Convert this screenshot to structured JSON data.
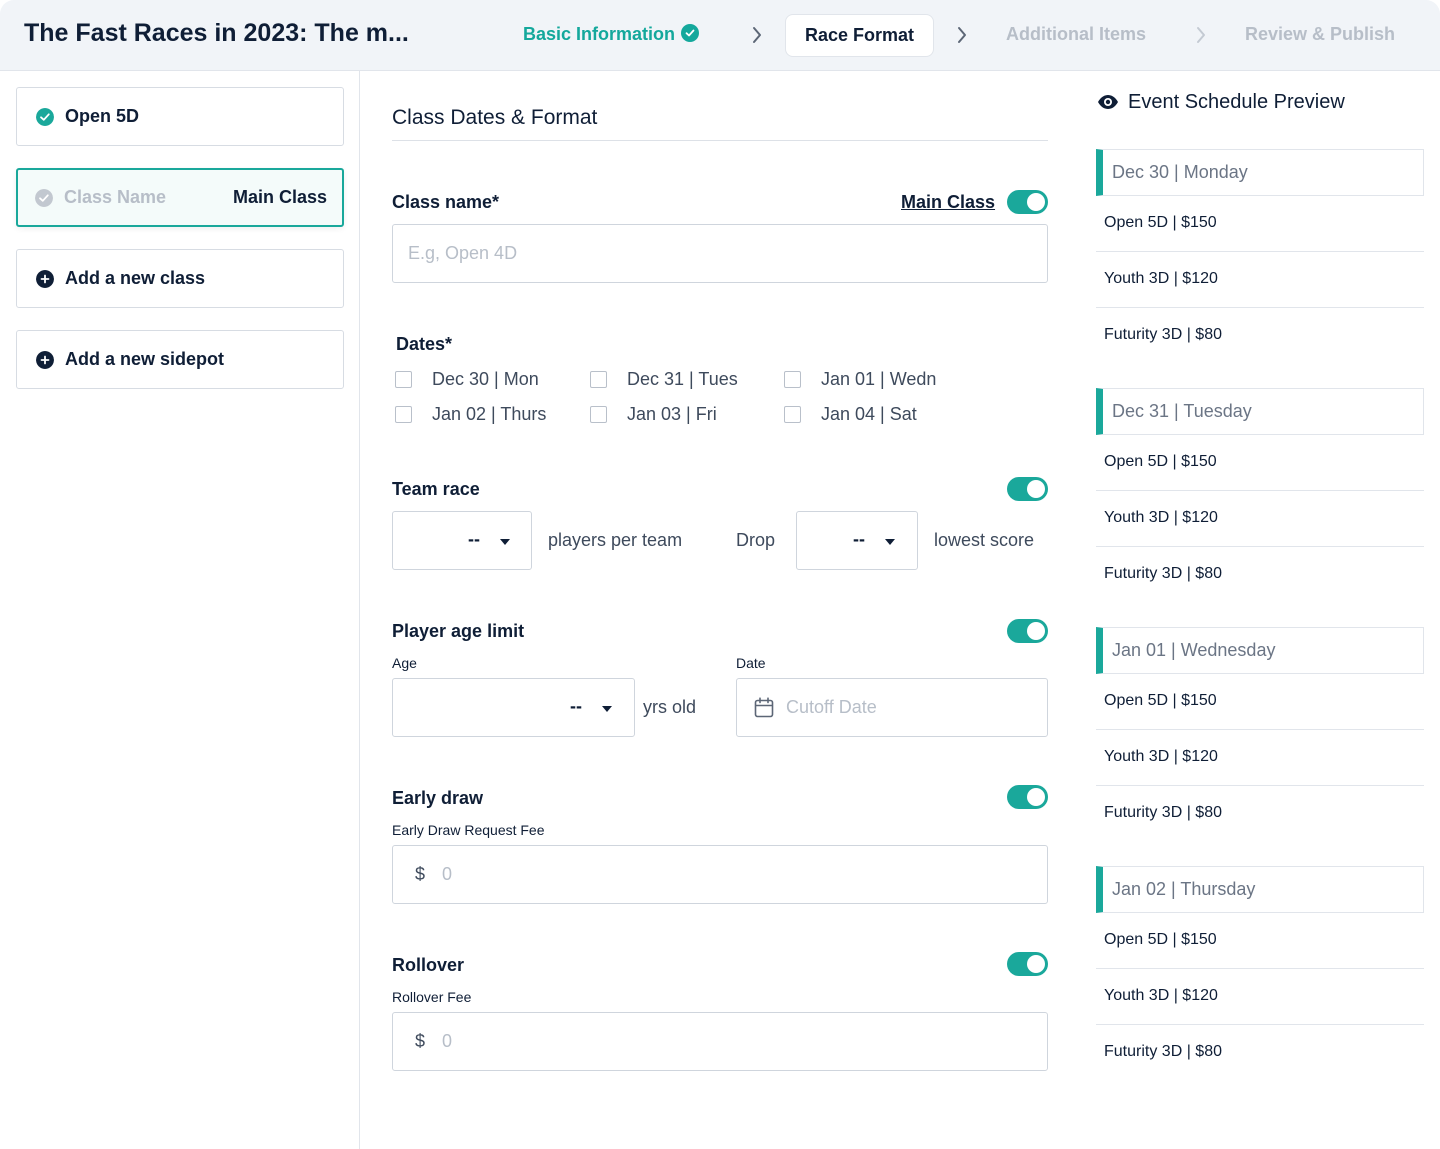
{
  "header": {
    "title": "The Fast Races in 2023: The m...",
    "steps": [
      {
        "label": "Basic Information",
        "state": "done"
      },
      {
        "label": "Race Format",
        "state": "active"
      },
      {
        "label": "Additional Items",
        "state": "upcoming"
      },
      {
        "label": "Review & Publish",
        "state": "upcoming"
      }
    ]
  },
  "sidebar": {
    "classes": [
      {
        "label": "Open 5D",
        "icon": "check-circle-icon"
      },
      {
        "label": "Class Name",
        "tag": "Main Class",
        "icon": "check-circle-icon"
      }
    ],
    "add_class_label": "Add a new class",
    "add_sidepot_label": "Add a new sidepot"
  },
  "form": {
    "section_title": "Class Dates & Format",
    "class_name_label": "Class name*",
    "main_class_label": "Main Class",
    "class_name_placeholder": "E.g, Open 4D",
    "dates_label": "Dates*",
    "dates": [
      {
        "label": "Dec 30 | Mon",
        "checked": false
      },
      {
        "label": "Dec 31 | Tues",
        "checked": false
      },
      {
        "label": "Jan 01 | Wedn",
        "checked": false
      },
      {
        "label": "Jan 02 | Thurs",
        "checked": false
      },
      {
        "label": "Jan 03 | Fri",
        "checked": false
      },
      {
        "label": "Jan 04 | Sat",
        "checked": false
      }
    ],
    "team_race": {
      "label": "Team race",
      "enabled": true,
      "players_value": "--",
      "players_text": "players per team",
      "drop_text": "Drop",
      "drop_value": "--",
      "lowest_text": "lowest score"
    },
    "age_limit": {
      "label": "Player age limit",
      "enabled": true,
      "age_label": "Age",
      "age_value": "--",
      "yrs_text": "yrs old",
      "date_label": "Date",
      "date_placeholder": "Cutoff Date"
    },
    "early_draw": {
      "label": "Early draw",
      "enabled": true,
      "fee_label": "Early Draw Request Fee",
      "currency": "$",
      "fee_placeholder": "0"
    },
    "rollover": {
      "label": "Rollover",
      "enabled": true,
      "fee_label": "Rollover Fee",
      "currency": "$",
      "fee_placeholder": "0"
    }
  },
  "preview": {
    "title": "Event Schedule Preview",
    "days": [
      {
        "label": "Dec 30 | Monday",
        "items": [
          "Open 5D | $150",
          "Youth 3D | $120",
          "Futurity 3D | $80"
        ]
      },
      {
        "label": "Dec 31 | Tuesday",
        "items": [
          "Open 5D | $150",
          "Youth 3D | $120",
          "Futurity 3D | $80"
        ]
      },
      {
        "label": "Jan 01 | Wednesday",
        "items": [
          "Open 5D | $150",
          "Youth 3D | $120",
          "Futurity 3D | $80"
        ]
      },
      {
        "label": "Jan 02 | Thursday",
        "items": [
          "Open 5D | $150",
          "Youth 3D | $120",
          "Futurity 3D | $80"
        ]
      }
    ]
  },
  "colors": {
    "accent": "#1aa89b",
    "text": "#0f1e36",
    "muted": "#b7bec8",
    "border": "#d7dce3"
  }
}
